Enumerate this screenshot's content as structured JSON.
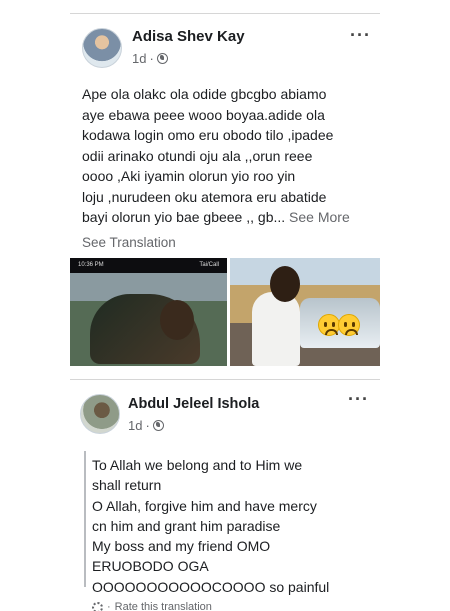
{
  "post1": {
    "author": "Adisa Shev Kay",
    "time": "1d",
    "text": "Ape ola olakc ola odide gbcgbo abiamo\naye ebawa peee wooo boyaa.adide ola\nkodawa login omo eru obodo tilo ,ipadee\nodii arinako otundi oju ala ,,orun reee\noooo ,Aki iyamin olorun yio roo yin\nloju ,nurudeen oku atemora eru abatide\nbayi olorun yio bae gbeee ,, gb...",
    "see_more": "See More",
    "see_translation": "See Translation",
    "photo1_status_time": "10:36 PM",
    "photo1_status_right": "Tai/Call"
  },
  "post2": {
    "author": "Abdul Jeleel Ishola",
    "time": "1d",
    "text": "To Allah we belong and to Him we\nshall return\nO Allah, forgive him and have mercy\ncn him and grant him paradise\nMy boss and my friend OMO\nERUOBODO OGA\nOOOOOOOOOOOCOOOO so painful",
    "rate_translation": "Rate this translation"
  },
  "icons": {
    "more": "more-options-icon",
    "globe": "globe-icon",
    "emoji": "crying-face-icon",
    "gear": "gear-icon"
  },
  "colors": {
    "secondary_text": "#65676b",
    "primary_text": "#1c1e21"
  }
}
